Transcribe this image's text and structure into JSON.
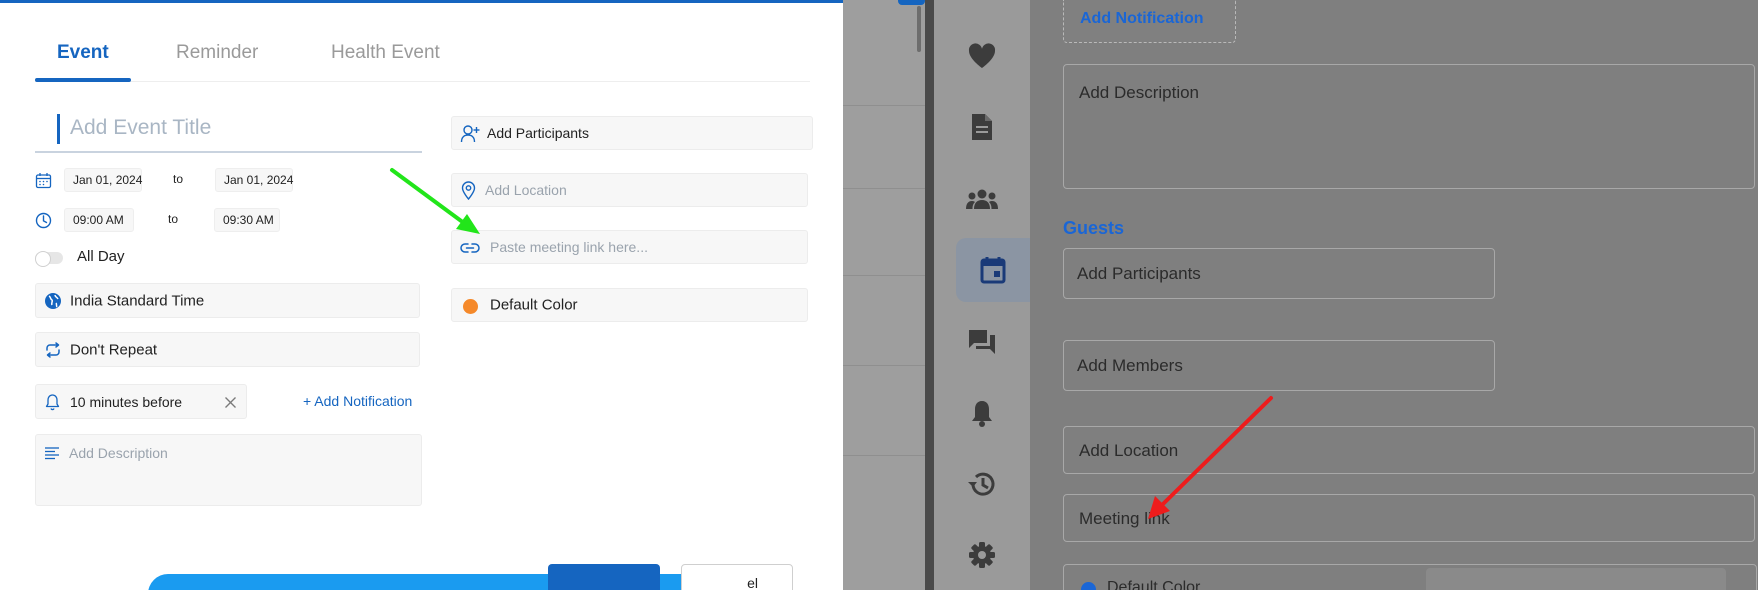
{
  "left_dialog": {
    "tabs": [
      "Event",
      "Reminder",
      "Health Event"
    ],
    "active_tab": "Event",
    "title_placeholder": "Add Event Title",
    "start_date": "Jan 01, 2024",
    "end_date": "Jan 01, 2024",
    "start_time": "09:00 AM",
    "end_time": "09:30 AM",
    "to_label": "to",
    "all_day_label": "All Day",
    "all_day_on": false,
    "timezone": "India Standard Time",
    "repeat": "Don't Repeat",
    "notification": "10 minutes before",
    "add_notification_link": "+ Add Notification",
    "description_placeholder": "Add Description",
    "add_participants": "Add Participants",
    "add_location_placeholder": "Add Location",
    "meeting_link_placeholder": "Paste meeting link here...",
    "color_label": "Default Color",
    "color_value": "#f5892a",
    "cancel_label": "el",
    "accent_color": "#1565c0"
  },
  "sidebar": {
    "icons": [
      "heart-icon",
      "document-icon",
      "group-icon",
      "calendar-icon",
      "chat-icon",
      "bell-icon",
      "history-icon",
      "gear-icon"
    ],
    "active_icon": "calendar-icon"
  },
  "right_panel": {
    "add_notification_label": "Add Notification",
    "description_placeholder": "Add Description",
    "guests_heading": "Guests",
    "participants_placeholder": "Add Participants",
    "members_placeholder": "Add Members",
    "location_placeholder": "Add Location",
    "meeting_link_placeholder": "Meeting link",
    "color_label": "Default Color"
  },
  "annotations": {
    "green_arrow_color": "#22e51a",
    "red_arrow_color": "#ee1c1c"
  }
}
